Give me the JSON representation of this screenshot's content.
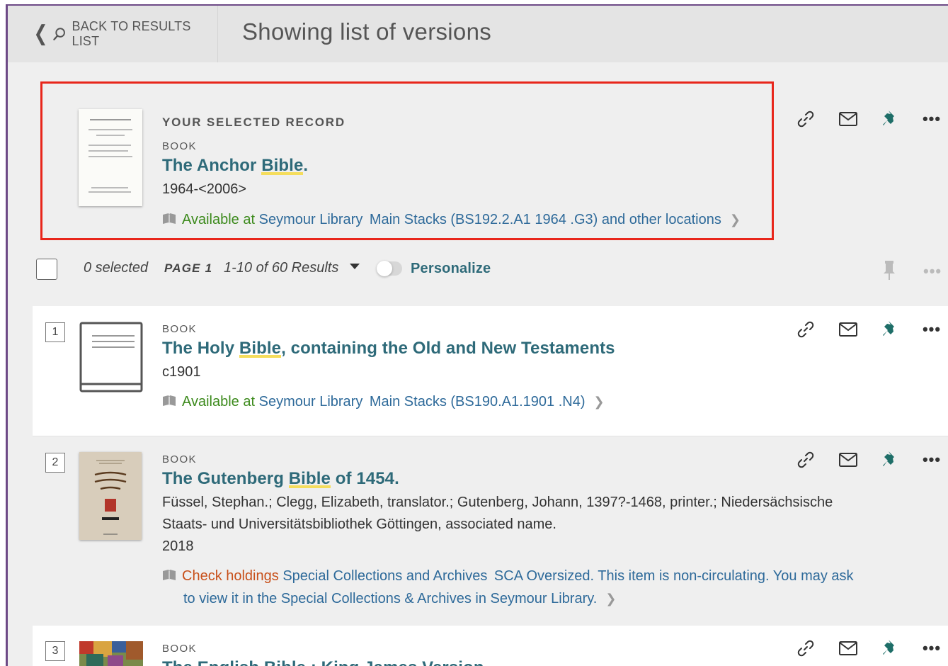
{
  "header": {
    "back_label": "BACK TO RESULTS LIST",
    "title": "Showing list of versions"
  },
  "selected_record": {
    "kicker": "YOUR SELECTED RECORD",
    "type": "BOOK",
    "title_pre": "The Anchor ",
    "title_hl": "Bible",
    "title_post": ".",
    "date": "1964-<2006>",
    "avail_status": "Available at",
    "library": "Seymour Library",
    "location": "Main Stacks (BS192.2.A1 1964 .G3) and other locations"
  },
  "toolbar": {
    "selected": "0 selected",
    "page": "PAGE 1",
    "results": "1-10 of 60 Results",
    "personalize": "Personalize"
  },
  "results": [
    {
      "num": "1",
      "type": "BOOK",
      "title_pre": "The Holy ",
      "title_hl": "Bible",
      "title_post": ", containing the Old and New Testaments",
      "meta1": "c1901",
      "avail_status": "Available at",
      "library": "Seymour Library",
      "location": "Main Stacks (BS190.A1.1901 .N4)"
    },
    {
      "num": "2",
      "type": "BOOK",
      "title_pre": "The Gutenberg ",
      "title_hl": "Bible",
      "title_post": " of 1454.",
      "meta1": "Füssel, Stephan.; Clegg, Elizabeth, translator.; Gutenberg, Johann, 1397?-1468, printer.; Niedersächsische",
      "meta2": "Staats- und Universitätsbibliothek Göttingen, associated name.",
      "meta3": "2018",
      "avail_status": "Check holdings",
      "library": "Special Collections and Archives",
      "location": "SCA Oversized. This item is non-circulating. You may ask",
      "location2": "to view it in the Special Collections & Archives in Seymour Library."
    },
    {
      "num": "3",
      "type": "BOOK",
      "title": "The English Bible : King James Version"
    }
  ],
  "icons": {
    "link": "link-icon",
    "email": "email-icon",
    "pin": "pin-icon",
    "more": "more-icon",
    "book_status": "book-icon"
  },
  "colors": {
    "title": "#2e6a79",
    "available": "#3c8a1c",
    "check_holdings": "#c8501a",
    "link": "#2e6a9a",
    "highlight": "#f5dd5c",
    "pin": "#1e6e68",
    "selection_box": "#e8261b"
  }
}
